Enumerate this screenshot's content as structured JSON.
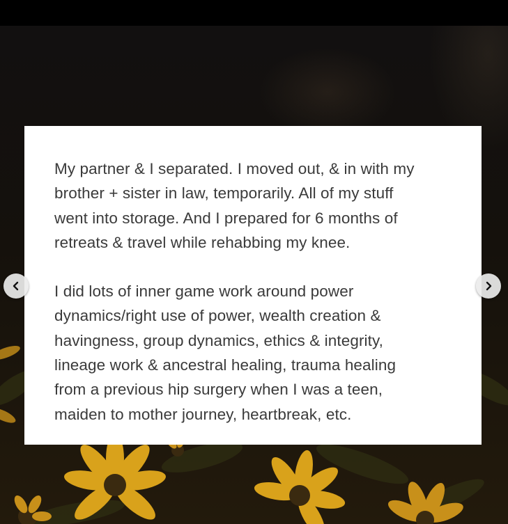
{
  "post": {
    "paragraphs": [
      "My partner & I separated. I moved out, & in with my\nbrother + sister in law, temporarily. All of my stuff\nwent into storage. And I prepared for 6 months of\nretreats & travel while rehabbing my knee.",
      "I did lots of inner game work around power\ndynamics/right use of power, wealth creation &\nhavingness, group dynamics, ethics & integrity,\nlineage work & ancestral healing, trauma healing\nfrom a previous hip surgery when I was a teen,\nmaiden to mother journey, heartbreak, etc."
    ]
  },
  "carousel": {
    "prev_icon": "chevron-left-icon",
    "next_icon": "chevron-right-icon"
  },
  "background": {
    "subject": "yellow flowers on dark background"
  },
  "colors": {
    "card": "#ffffff",
    "text": "#3a3a3a",
    "flower": "#d9a21b",
    "flower_center": "#3a2a10",
    "nav_button": "#ebebeb"
  }
}
